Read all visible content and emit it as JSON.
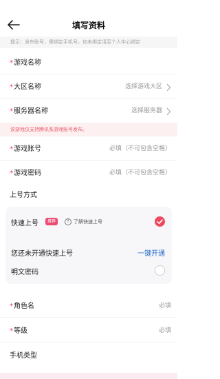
{
  "header": {
    "title": "填写资料"
  },
  "tip": "提示：发布账号，需绑定手机号，如未绑定请至个人中心绑定",
  "fields": {
    "game_name": {
      "label": "游戏名称",
      "required": "*"
    },
    "region": {
      "label": "大区名称",
      "required": "*",
      "placeholder": "选择游戏大区"
    },
    "server": {
      "label": "服务器名称",
      "required": "*",
      "placeholder": "选择服务器"
    },
    "account": {
      "label": "游戏账号",
      "required": "*",
      "placeholder": "必填（不可包含空格）"
    },
    "password": {
      "label": "游戏密码",
      "required": "*",
      "placeholder": "必填（不可包含空格）"
    },
    "login_method": {
      "label": "上号方式"
    },
    "role_name": {
      "label": "角色名",
      "required": "*",
      "placeholder": "必填"
    },
    "level": {
      "label": "等级",
      "required": "*",
      "placeholder": "必填"
    },
    "phone_type": {
      "label": "手机类型"
    }
  },
  "warning": "该游戏仅支持腾讯系游戏账号发布。",
  "login_card": {
    "fast_label": "快速上号",
    "badge": "推荐",
    "help": "了解快速上号",
    "not_enabled": "您还未开通快速上号",
    "enable_link": "一键开通",
    "plain_password": "明文密码"
  },
  "colors": {
    "accent": "#ec4a5e",
    "link": "#2a6fc9",
    "warning_bg": "#fdf0f0",
    "tip_bg": "#f6f6f6"
  },
  "icons": {
    "back": "arrow-left-icon",
    "chevron": "chevron-right-icon",
    "check": "check-circle-icon",
    "help": "question-circle-icon"
  }
}
